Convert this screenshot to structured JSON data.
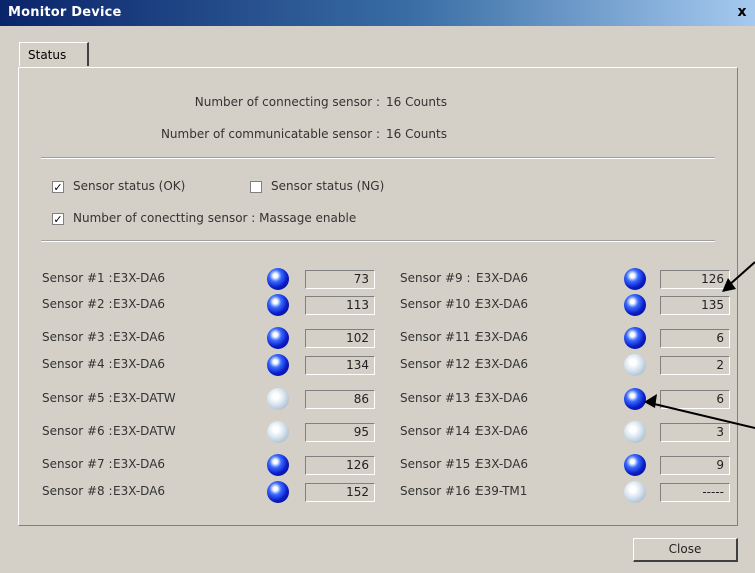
{
  "window": {
    "title": "Monitor Device",
    "close_glyph": "x"
  },
  "tab": {
    "label": "Status"
  },
  "summary": {
    "connecting_label": "Number of connecting sensor :",
    "connecting_value": "16 Counts",
    "communicatable_label": "Number of communicatable sensor :",
    "communicatable_value": "16 Counts"
  },
  "options": {
    "status_ok": {
      "label": "Sensor status (OK)",
      "checked": true
    },
    "status_ng": {
      "label": "Sensor status (NG)",
      "checked": false
    },
    "message_enable": {
      "label": "Number of conectting sensor : Massage enable",
      "checked": true
    }
  },
  "sensors": [
    {
      "label": "Sensor #1 :",
      "model": "E3X-DA6",
      "led": "on",
      "value": "73"
    },
    {
      "label": "Sensor #2 :",
      "model": "E3X-DA6",
      "led": "on",
      "value": "113"
    },
    {
      "label": "Sensor #3 :",
      "model": "E3X-DA6",
      "led": "on",
      "value": "102"
    },
    {
      "label": "Sensor #4 :",
      "model": "E3X-DA6",
      "led": "on",
      "value": "134"
    },
    {
      "label": "Sensor #5 :",
      "model": "E3X-DATW",
      "led": "off",
      "value": "86"
    },
    {
      "label": "Sensor #6 :",
      "model": "E3X-DATW",
      "led": "off",
      "value": "95"
    },
    {
      "label": "Sensor #7 :",
      "model": "E3X-DA6",
      "led": "on",
      "value": "126"
    },
    {
      "label": "Sensor #8 :",
      "model": "E3X-DA6",
      "led": "on",
      "value": "152"
    },
    {
      "label": "Sensor #9 :",
      "model": "E3X-DA6",
      "led": "on",
      "value": "126"
    },
    {
      "label": "Sensor #10 :",
      "model": "E3X-DA6",
      "led": "on",
      "value": "135"
    },
    {
      "label": "Sensor #11 :",
      "model": "E3X-DA6",
      "led": "on",
      "value": "6"
    },
    {
      "label": "Sensor #12 :",
      "model": "E3X-DA6",
      "led": "off",
      "value": "2"
    },
    {
      "label": "Sensor #13 :",
      "model": "E3X-DA6",
      "led": "on",
      "value": "6"
    },
    {
      "label": "Sensor #14 :",
      "model": "E3X-DA6",
      "led": "off",
      "value": "3"
    },
    {
      "label": "Sensor #15 :",
      "model": "E3X-DA6",
      "led": "on",
      "value": "9"
    },
    {
      "label": "Sensor #16 :",
      "model": "E39-TM1",
      "led": "off",
      "value": "-----"
    }
  ],
  "buttons": {
    "close_label": "Close"
  },
  "colors": {
    "title_start": "#0a246a",
    "title_end": "#a6caf0",
    "dialog_bg": "#d4d0c8",
    "led_on": "#0a1cc8",
    "led_off": "#c8d6e2"
  }
}
